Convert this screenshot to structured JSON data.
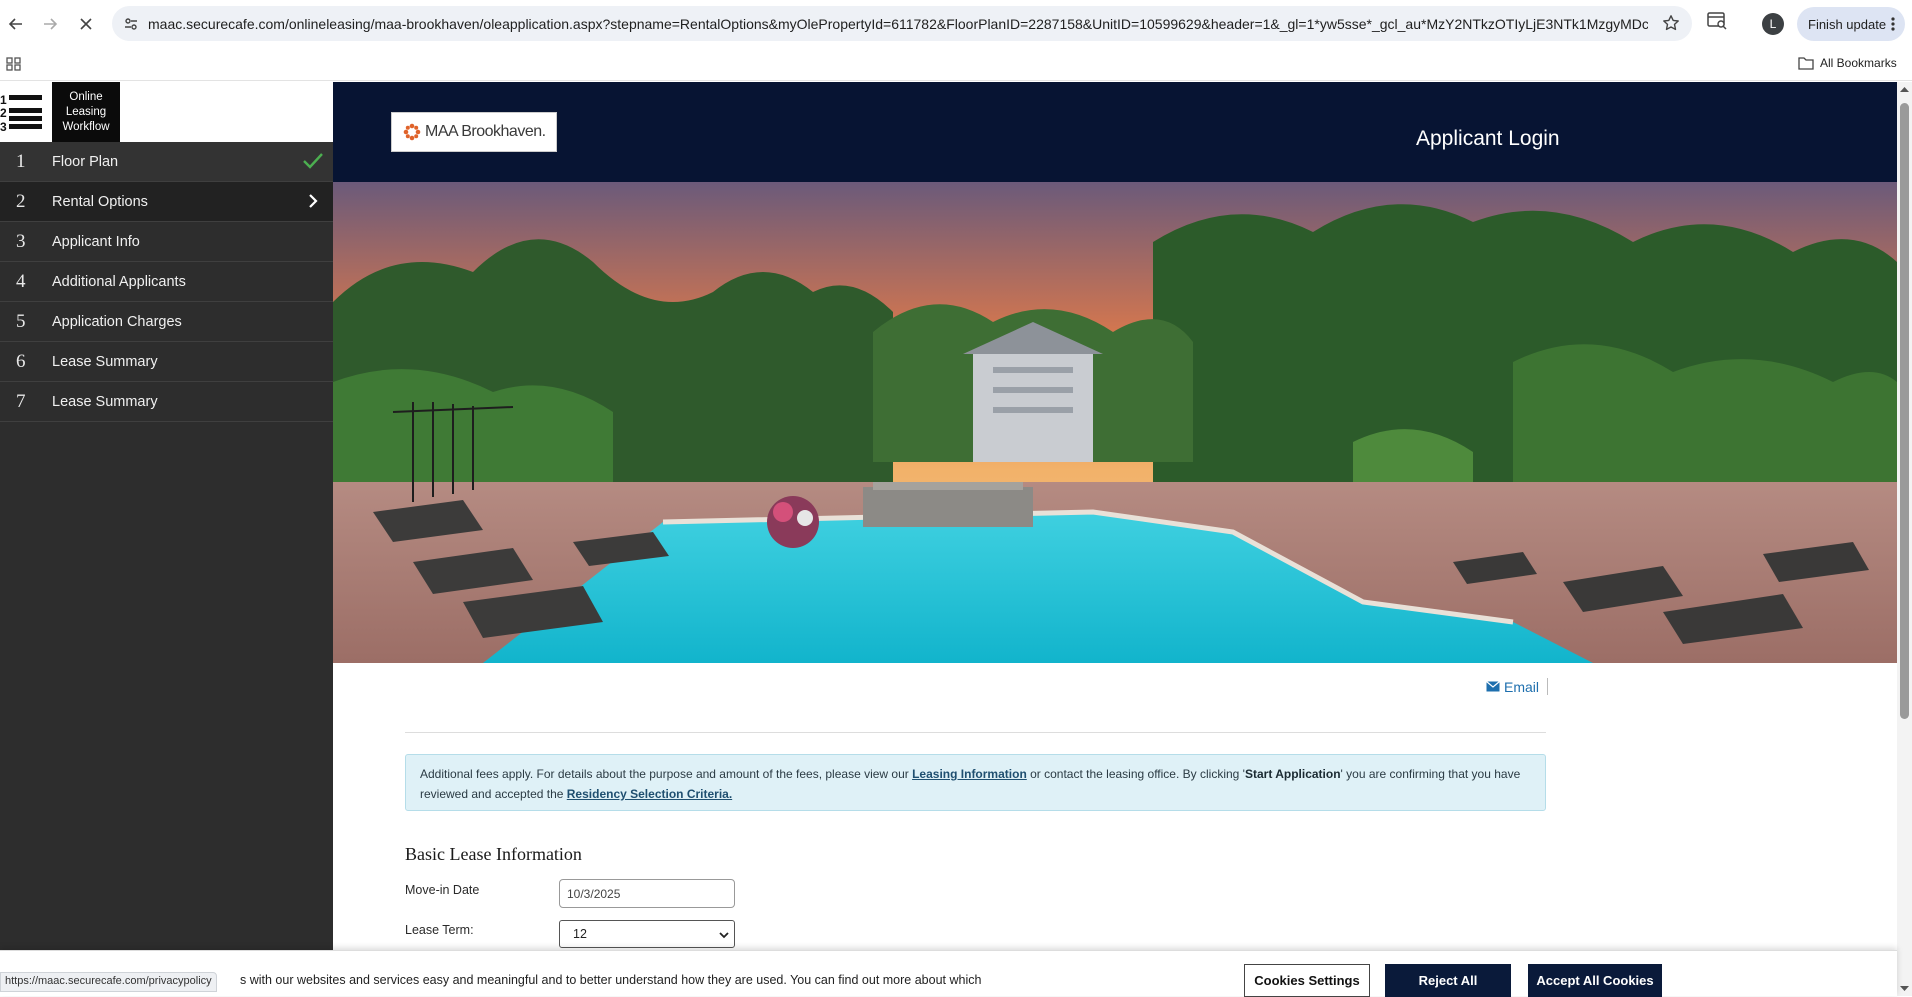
{
  "browser": {
    "url": "maac.securecafe.com/onlineleasing/maa-brookhaven/oleapplication.aspx?stepname=RentalOptions&myOlePropertyId=611782&FloorPlanID=2287158&UnitID=10599629&header=1&_gl=1*yw5sse*_gcl_au*MzY2NTkzOTIyLjE3NTk1MzgyMDc...",
    "profile_initial": "L",
    "finish_update_label": "Finish update",
    "all_bookmarks_label": "All Bookmarks",
    "status_url": "https://maac.securecafe.com/privacypolicy"
  },
  "sidebar": {
    "workflow_label": "Online Leasing Workflow",
    "steps": [
      {
        "num": "1",
        "label": "Floor Plan",
        "state": "done"
      },
      {
        "num": "2",
        "label": "Rental Options",
        "state": "active"
      },
      {
        "num": "3",
        "label": "Applicant Info",
        "state": "pending"
      },
      {
        "num": "4",
        "label": "Additional Applicants",
        "state": "pending"
      },
      {
        "num": "5",
        "label": "Application Charges",
        "state": "pending"
      },
      {
        "num": "6",
        "label": "Lease Summary",
        "state": "pending"
      },
      {
        "num": "7",
        "label": "Lease Summary",
        "state": "pending"
      }
    ]
  },
  "header": {
    "logo_text": "MAA Brookhaven.",
    "applicant_login": "Applicant Login"
  },
  "main": {
    "email_label": "Email",
    "notice": {
      "part1": "Additional fees apply.  For details about the purpose and amount of the fees, please view our ",
      "link1": "Leasing Information",
      "part2": " or contact the leasing office.  By clicking '",
      "bold": "Start Application",
      "part3": "' you are confirming that you have reviewed and accepted the ",
      "link2": "Residency Selection Criteria."
    },
    "section_title": "Basic Lease Information",
    "move_in_label": "Move-in Date",
    "move_in_value": "10/3/2025",
    "lease_term_label": "Lease Term:",
    "lease_term_value": "12"
  },
  "cookie": {
    "text": "s with our websites and services easy and meaningful and to better understand how they are used. You can find out more about which",
    "settings_label": "Cookies Settings",
    "reject_label": "Reject All",
    "accept_label": "Accept All Cookies"
  },
  "colors": {
    "header_navy": "#071433",
    "sidebar_dark": "#2d2d2d",
    "check_green": "#4caf50",
    "link_blue": "#1e6fae",
    "notice_bg": "#dff1f7"
  }
}
